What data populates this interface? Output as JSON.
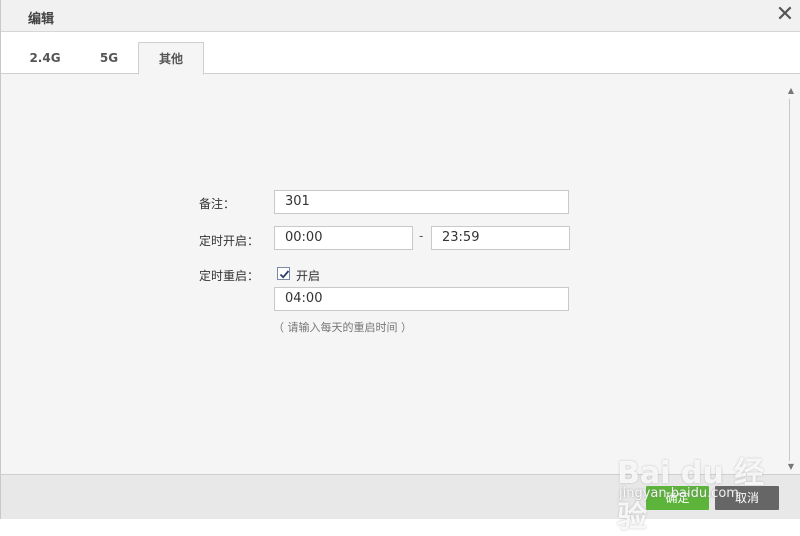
{
  "dialog": {
    "title": "编辑",
    "close_glyph": "✕"
  },
  "tabs": [
    {
      "label": "2.4G",
      "active": false
    },
    {
      "label": "5G",
      "active": false
    },
    {
      "label": "其他",
      "active": true
    }
  ],
  "form": {
    "remark": {
      "label": "备注：",
      "value": "301"
    },
    "schedule": {
      "label": "定时开启：",
      "start": "00:00",
      "separator": "-",
      "end": "23:59"
    },
    "reboot": {
      "label": "定时重启：",
      "checkbox_label": "开启",
      "checked": true,
      "time": "04:00",
      "hint": "（ 请输入每天的重启时间 ）"
    }
  },
  "footer": {
    "ok_label": "确定",
    "cancel_label": "取消"
  },
  "watermark": {
    "brand": "Bai du 经验",
    "url": "jingyan.baidu.com"
  },
  "colors": {
    "ok_button": "#5cb43a",
    "cancel_button": "#666666"
  }
}
